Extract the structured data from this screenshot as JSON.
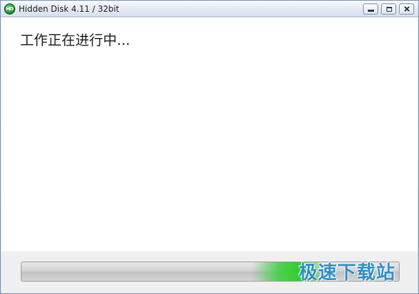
{
  "window": {
    "title": "Hidden Disk 4.11 / 32bit",
    "app_icon_text": "HD"
  },
  "caption_buttons": {
    "minimize_icon": "minimize-icon",
    "maximize_icon": "maximize-icon",
    "close_icon": "close-icon"
  },
  "content": {
    "status": "工作正在进行中..."
  },
  "progress": {
    "mode": "marquee",
    "glow_start": 0.61,
    "glow_end": 0.79,
    "accent": "#2fcf2f"
  },
  "watermark": {
    "text": "极速下载站",
    "color": "#2b8cc4"
  }
}
